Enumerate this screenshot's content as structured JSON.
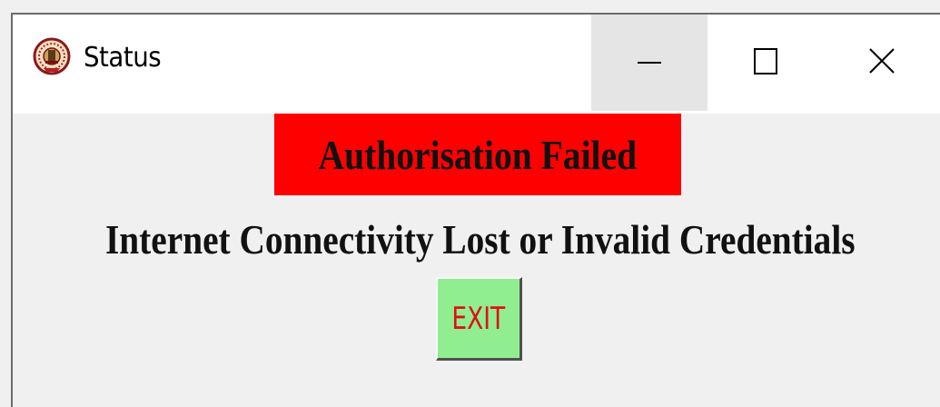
{
  "window": {
    "title": "Status",
    "icon": "university-emblem-icon",
    "controls": {
      "minimize": "minimize-icon",
      "maximize": "maximize-icon",
      "close": "close-icon"
    }
  },
  "content": {
    "banner_text": "Authorisation Failed",
    "banner_color": "#ff0000",
    "message": "Internet Connectivity Lost or Invalid Credentials",
    "exit_label": "EXIT",
    "exit_bg_color": "#90ee90",
    "exit_text_color": "#e01010"
  }
}
